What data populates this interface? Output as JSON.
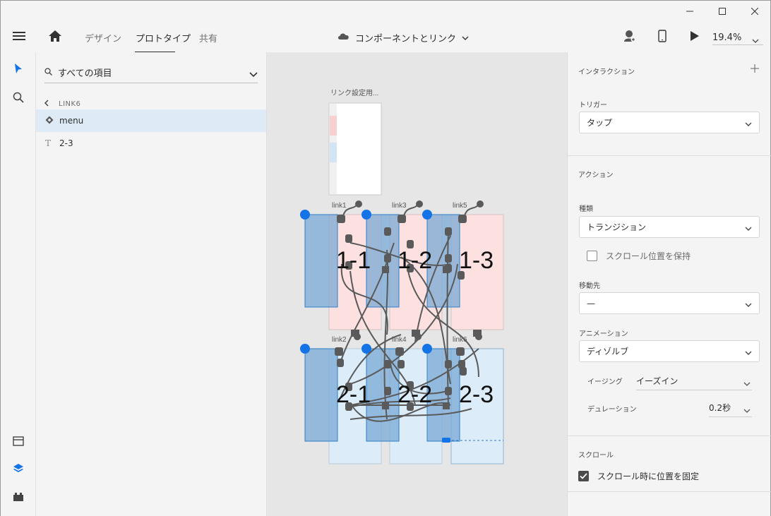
{
  "window": {
    "minimize_icon": "minimize-icon",
    "maximize_icon": "maximize-icon",
    "close_icon": "close-icon"
  },
  "toolbar": {
    "tabs": [
      {
        "label": "デザイン",
        "active": false
      },
      {
        "label": "プロトタイプ",
        "active": true
      },
      {
        "label": "共有",
        "active": false
      }
    ],
    "document_title": "コンポーネントとリンク",
    "zoom": "19.4%"
  },
  "layers_panel": {
    "search_value": "すべての項目",
    "breadcrumb": "LINK6",
    "items": [
      {
        "label": "menu",
        "icon": "component-icon",
        "selected": true
      },
      {
        "label": "2-3",
        "icon": "text-icon",
        "selected": false
      }
    ]
  },
  "canvas": {
    "menu_artboard_label": "リンク設定用...",
    "artboard_labels": [
      "link1",
      "link3",
      "link5",
      "link2",
      "link4",
      "link6"
    ],
    "artboard_titles": [
      "1-1",
      "1-2",
      "1-3",
      "2-1",
      "2-2",
      "2-3"
    ],
    "colors": {
      "pink": "#fde0e0",
      "blue": "#dcecf8",
      "overlay": "#7aa9d6",
      "connector": "#5a5a5a",
      "accent": "#1473e6"
    }
  },
  "properties": {
    "interaction_header": "インタラクション",
    "trigger_label": "トリガー",
    "trigger_value": "タップ",
    "action_header": "アクション",
    "type_label": "種類",
    "type_value": "トランジション",
    "preserve_scroll_label": "スクロール位置を保持",
    "preserve_scroll_checked": false,
    "destination_label": "移動先",
    "destination_value": "—",
    "animation_label": "アニメーション",
    "animation_value": "ディゾルブ",
    "easing_label": "イージング",
    "easing_value": "イーズイン",
    "duration_label": "デュレーション",
    "duration_value": "0.2秒",
    "scroll_header": "スクロール",
    "fix_position_label": "スクロール時に位置を固定",
    "fix_position_checked": true
  }
}
